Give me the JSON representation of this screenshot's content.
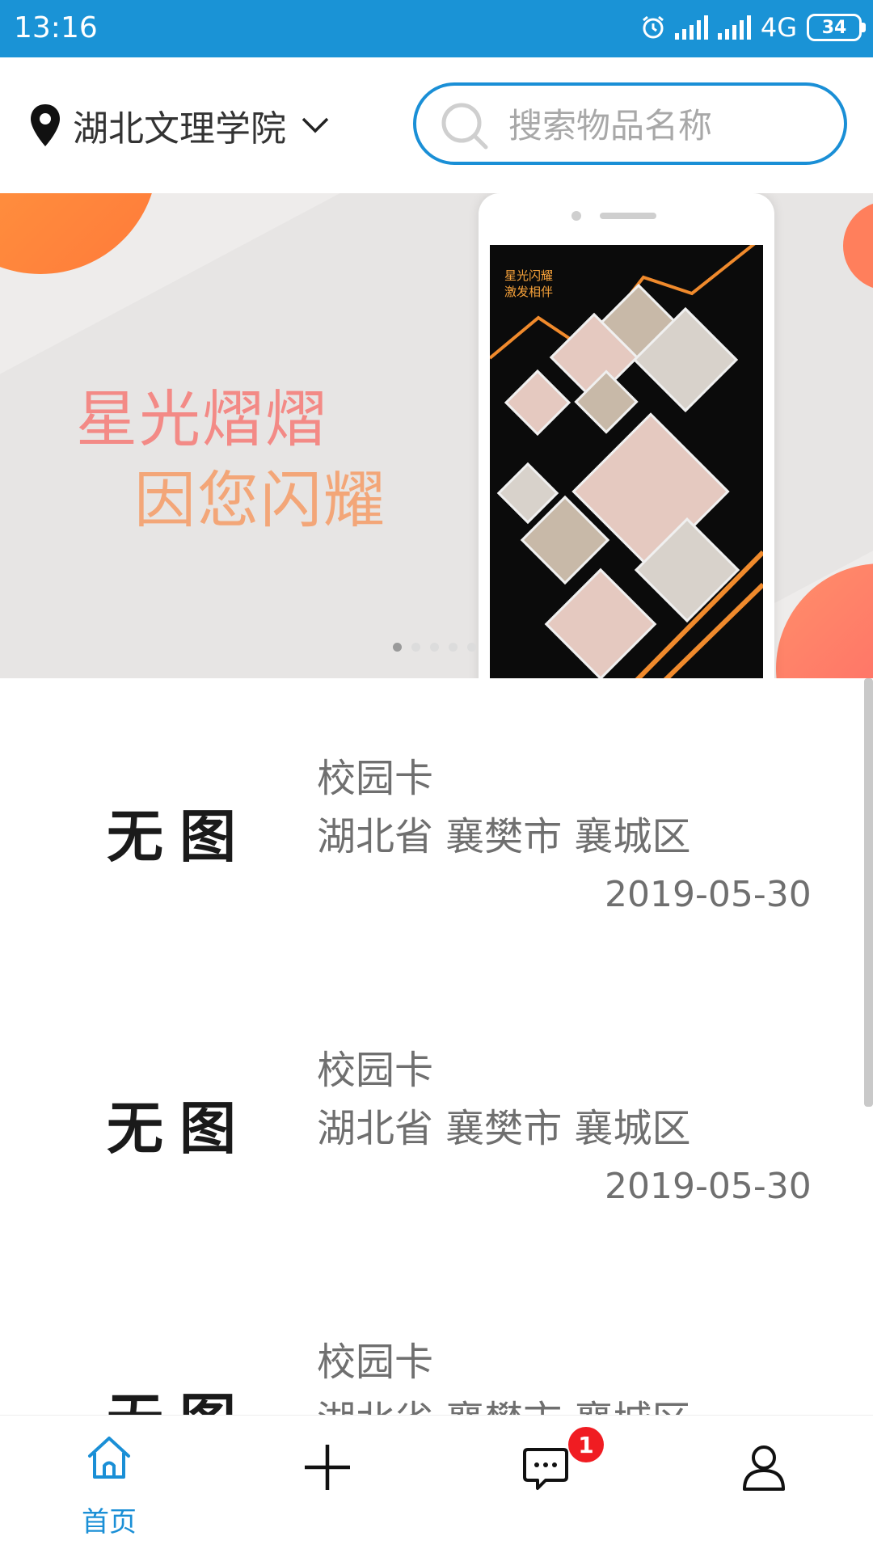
{
  "status_bar": {
    "time": "13:16",
    "network": "4G",
    "battery": "34",
    "icons": [
      "alarm-icon",
      "signal-icon",
      "signal-icon",
      "battery-icon"
    ]
  },
  "header": {
    "location": "湖北文理学院",
    "location_icon": "map-pin-icon",
    "dropdown_icon": "chevron-down-icon",
    "search": {
      "placeholder": "搜索物品名称",
      "value": "",
      "icon": "search-icon"
    },
    "accent_color": "#1a8fd6"
  },
  "banner": {
    "slogan_line1": "星光熠熠",
    "slogan_line2": "因您闪耀",
    "phone_screen_title": "星光闪耀\n激发相伴",
    "page_count": 5,
    "active_page": 1
  },
  "list": {
    "items": [
      {
        "thumb": "无图",
        "title": "校园卡",
        "address": "湖北省 襄樊市 襄城区",
        "date": "2019-05-30"
      },
      {
        "thumb": "无图",
        "title": "校园卡",
        "address": "湖北省 襄樊市 襄城区",
        "date": "2019-05-30"
      },
      {
        "thumb": "无图",
        "title": "校园卡",
        "address": "湖北省 襄樊市 襄城区",
        "date": ""
      }
    ]
  },
  "bottom_nav": {
    "tabs": [
      {
        "label": "首页",
        "icon": "home-icon",
        "active": true
      },
      {
        "label": "",
        "icon": "plus-icon",
        "active": false
      },
      {
        "label": "",
        "icon": "message-icon",
        "active": false,
        "badge": "1"
      },
      {
        "label": "",
        "icon": "user-icon",
        "active": false
      }
    ]
  }
}
